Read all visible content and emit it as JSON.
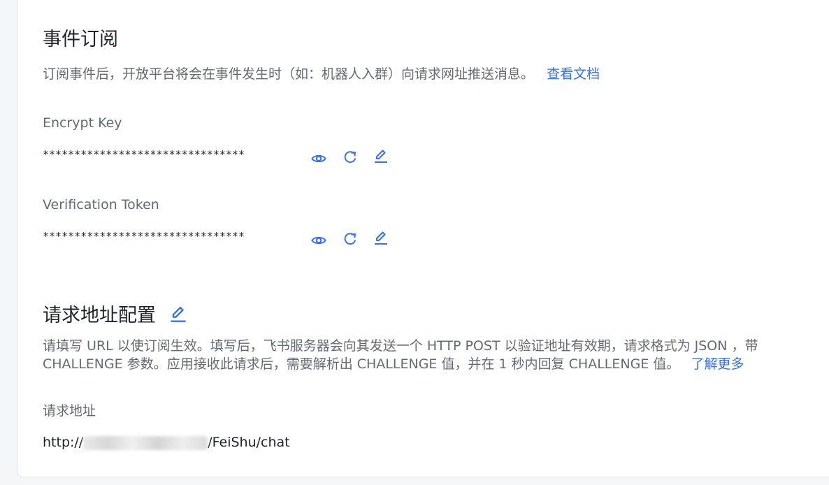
{
  "section_events": {
    "title": "事件订阅",
    "description": "订阅事件后，开放平台将会在事件发生时（如：机器人入群）向请求网址推送消息。",
    "doc_link": "查看文档"
  },
  "encrypt_key": {
    "label": "Encrypt Key",
    "value": "********************************"
  },
  "verification_token": {
    "label": "Verification Token",
    "value": "********************************"
  },
  "section_request": {
    "title": "请求地址配置",
    "description_line1": "请填写 URL 以使订阅生效。填写后，飞书服务器会向其发送一个 HTTP POST 以验证地址有效期，请求格式为 JSON ，带",
    "description_line2": "CHALLENGE 参数。应用接收此请求后，需要解析出 CHALLENGE 值，并在 1 秒内回复 CHALLENGE 值。",
    "learn_more": "了解更多",
    "url_label": "请求地址",
    "url_prefix": "http://",
    "url_suffix": "/FeiShu/chat"
  },
  "icons": {
    "show": "eye-icon",
    "reset": "refresh-icon",
    "edit": "edit-icon"
  },
  "colors": {
    "accent": "#3370ff",
    "text_primary": "#1f2329",
    "text_secondary": "#646a73"
  }
}
